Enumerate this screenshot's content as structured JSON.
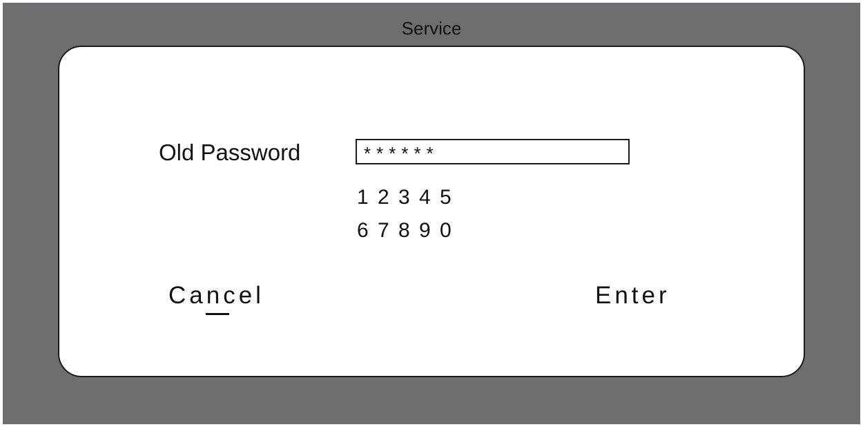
{
  "window": {
    "title": "Service"
  },
  "form": {
    "old_password_label": "Old Password",
    "old_password_value": "******"
  },
  "keypad": {
    "rows": [
      [
        "1",
        "2",
        "3",
        "4",
        "5"
      ],
      [
        "6",
        "7",
        "8",
        "9",
        "0"
      ]
    ]
  },
  "actions": {
    "cancel_label": "Cancel",
    "cancel_hotkey": "n",
    "enter_label": "Enter"
  },
  "colors": {
    "background": "#6e6e71",
    "panel": "#ffffff",
    "text": "#111111"
  }
}
